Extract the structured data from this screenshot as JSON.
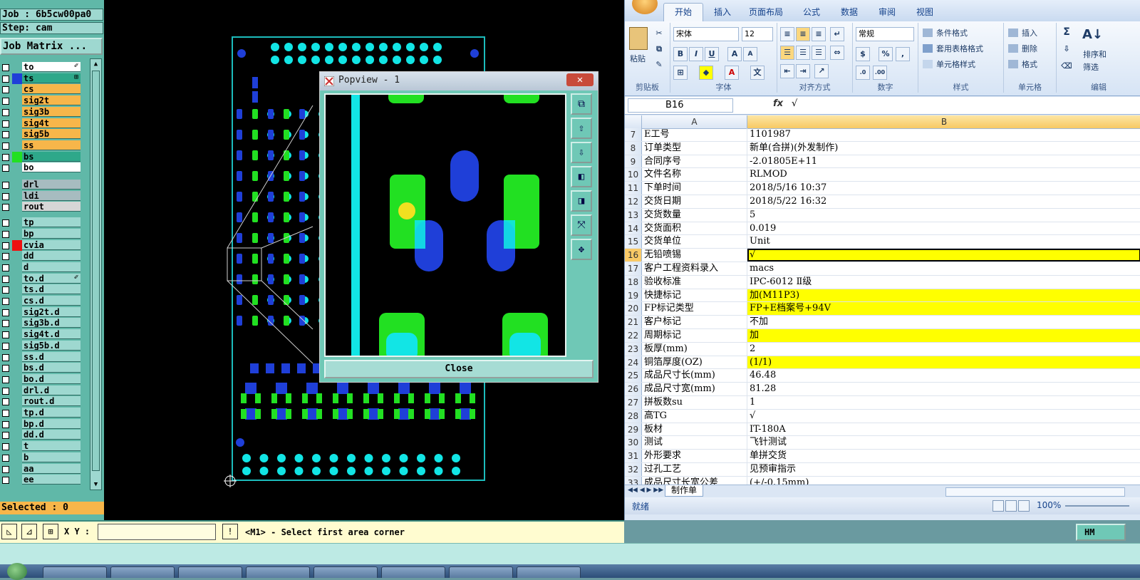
{
  "cam": {
    "job_label": "Job : 6b5cw00pa0",
    "step_label": "Step: cam",
    "job_matrix_button": "Job Matrix ...",
    "selected_label": "Selected : 0",
    "layers": [
      {
        "name": "to",
        "color": "#ffffff",
        "swatch": "",
        "mark": "✐"
      },
      {
        "name": "ts",
        "color": "#2ea88a",
        "swatch": "#1f3fd8",
        "mark": "⊞"
      },
      {
        "name": "cs",
        "color": "#f7b64a",
        "swatch": "",
        "mark": ""
      },
      {
        "name": "sig2t",
        "color": "#f7b64a",
        "swatch": "",
        "mark": ""
      },
      {
        "name": "sig3b",
        "color": "#f7b64a",
        "swatch": "",
        "mark": ""
      },
      {
        "name": "sig4t",
        "color": "#f7b64a",
        "swatch": "",
        "mark": ""
      },
      {
        "name": "sig5b",
        "color": "#f7b64a",
        "swatch": "",
        "mark": ""
      },
      {
        "name": "ss",
        "color": "#f7b64a",
        "swatch": "",
        "mark": ""
      },
      {
        "name": "bs",
        "color": "#2ea88a",
        "swatch": "#22e022",
        "mark": ""
      },
      {
        "name": "bo",
        "color": "#ffffff",
        "swatch": "",
        "mark": ""
      },
      {
        "name": "drl",
        "color": "#a7bcc0",
        "swatch": "",
        "mark": ""
      },
      {
        "name": "ldi",
        "color": "#a7bcc0",
        "swatch": "",
        "mark": ""
      },
      {
        "name": "rout",
        "color": "#d6d6d6",
        "swatch": "",
        "mark": ""
      },
      {
        "name": "tp",
        "color": "#9ed8d0",
        "swatch": "",
        "mark": ""
      },
      {
        "name": "bp",
        "color": "#9ed8d0",
        "swatch": "",
        "mark": ""
      },
      {
        "name": "cvia",
        "color": "#9ed8d0",
        "swatch": "#ee1111",
        "mark": ""
      },
      {
        "name": "dd",
        "color": "#9ed8d0",
        "swatch": "",
        "mark": ""
      },
      {
        "name": "d",
        "color": "#9ed8d0",
        "swatch": "",
        "mark": ""
      },
      {
        "name": "to.d",
        "color": "#9ed8d0",
        "swatch": "",
        "mark": "✐"
      },
      {
        "name": "ts.d",
        "color": "#9ed8d0",
        "swatch": "",
        "mark": ""
      },
      {
        "name": "cs.d",
        "color": "#9ed8d0",
        "swatch": "",
        "mark": ""
      },
      {
        "name": "sig2t.d",
        "color": "#9ed8d0",
        "swatch": "",
        "mark": ""
      },
      {
        "name": "sig3b.d",
        "color": "#9ed8d0",
        "swatch": "",
        "mark": ""
      },
      {
        "name": "sig4t.d",
        "color": "#9ed8d0",
        "swatch": "",
        "mark": ""
      },
      {
        "name": "sig5b.d",
        "color": "#9ed8d0",
        "swatch": "",
        "mark": ""
      },
      {
        "name": "ss.d",
        "color": "#9ed8d0",
        "swatch": "",
        "mark": ""
      },
      {
        "name": "bs.d",
        "color": "#9ed8d0",
        "swatch": "",
        "mark": ""
      },
      {
        "name": "bo.d",
        "color": "#9ed8d0",
        "swatch": "",
        "mark": ""
      },
      {
        "name": "drl.d",
        "color": "#9ed8d0",
        "swatch": "",
        "mark": ""
      },
      {
        "name": "rout.d",
        "color": "#9ed8d0",
        "swatch": "",
        "mark": ""
      },
      {
        "name": "tp.d",
        "color": "#9ed8d0",
        "swatch": "",
        "mark": ""
      },
      {
        "name": "bp.d",
        "color": "#9ed8d0",
        "swatch": "",
        "mark": ""
      },
      {
        "name": "dd.d",
        "color": "#9ed8d0",
        "swatch": "",
        "mark": ""
      },
      {
        "name": "t",
        "color": "#9ed8d0",
        "swatch": "",
        "mark": ""
      },
      {
        "name": "b",
        "color": "#9ed8d0",
        "swatch": "",
        "mark": ""
      },
      {
        "name": "aa",
        "color": "#9ed8d0",
        "swatch": "",
        "mark": ""
      },
      {
        "name": "ee",
        "color": "#9ed8d0",
        "swatch": "",
        "mark": ""
      }
    ],
    "popview": {
      "title": "Popview - 1",
      "close_x": "✕",
      "close_button": "Close",
      "tools": [
        "zoom-window-icon",
        "layer-up-icon",
        "layer-down-icon",
        "pan-left-icon",
        "pan-right-icon",
        "zoom-fit-icon",
        "zoom-home-icon"
      ]
    },
    "xy_label": "X Y :",
    "xy_value": "",
    "message": "<M1> - Select first area corner",
    "info_button": "!",
    "hm_button": "HM",
    "colors": {
      "copper": "#22e022",
      "pad": "#1f3fd8",
      "via": "#12e5e5",
      "board": "#1cbcbc"
    }
  },
  "excel": {
    "ribbon_tabs": [
      "开始",
      "插入",
      "页面布局",
      "公式",
      "数据",
      "审阅",
      "视图"
    ],
    "clipboard": {
      "paste": "粘贴",
      "label": "剪贴板"
    },
    "font": {
      "name": "宋体",
      "size": "12",
      "label": "字体"
    },
    "alignment_label": "对齐方式",
    "number": {
      "format": "常规",
      "label": "数字"
    },
    "styles": {
      "conditional": "条件格式",
      "table": "套用表格格式",
      "cell": "单元格样式",
      "label": "样式"
    },
    "cells": {
      "insert": "插入",
      "delete": "删除",
      "format": "格式",
      "label": "单元格"
    },
    "editing": {
      "sigma": "Σ",
      "sort": "排序和",
      "filter": "筛选",
      "label": "编辑"
    },
    "name_box": "B16",
    "fx": "fx",
    "formula": "√",
    "col_a": "A",
    "col_b": "B",
    "rows": [
      {
        "n": "7",
        "a": "E工号",
        "b": "1101987",
        "hl": false
      },
      {
        "n": "8",
        "a": "订单类型",
        "b": "新单(合拼)(外发制作)",
        "hl": false
      },
      {
        "n": "9",
        "a": "合同序号",
        "b": "-2.01805E+11",
        "hl": false
      },
      {
        "n": "10",
        "a": "文件名称",
        "b": "RLMOD",
        "hl": false
      },
      {
        "n": "11",
        "a": "下单时间",
        "b": "2018/5/16 10:37",
        "hl": false
      },
      {
        "n": "12",
        "a": "交货日期",
        "b": "2018/5/22 16:32",
        "hl": false
      },
      {
        "n": "13",
        "a": "交货数量",
        "b": "5",
        "hl": false
      },
      {
        "n": "14",
        "a": "交货面积",
        "b": "0.019",
        "hl": false
      },
      {
        "n": "15",
        "a": "交货单位",
        "b": "Unit",
        "hl": false
      },
      {
        "n": "16",
        "a": "无铅喷锡",
        "b": "√",
        "hl": true
      },
      {
        "n": "17",
        "a": "客户工程资料录入",
        "b": "macs",
        "hl": false
      },
      {
        "n": "18",
        "a": "验收标准",
        "b": "IPC-6012 Ⅱ级",
        "hl": false
      },
      {
        "n": "19",
        "a": "快捷标记",
        "b": "加(M11P3)",
        "hl": true
      },
      {
        "n": "20",
        "a": "FP标记类型",
        "b": "FP+E档案号+94V",
        "hl": true
      },
      {
        "n": "21",
        "a": "客户标记",
        "b": "不加",
        "hl": false
      },
      {
        "n": "22",
        "a": "周期标记",
        "b": "加",
        "hl": true
      },
      {
        "n": "23",
        "a": "板厚(mm)",
        "b": "2",
        "hl": false
      },
      {
        "n": "24",
        "a": "铜箔厚度(OZ)",
        "b": " (1/1)",
        "hl": true
      },
      {
        "n": "25",
        "a": "成品尺寸长(mm)",
        "b": "46.48",
        "hl": false
      },
      {
        "n": "26",
        "a": "成品尺寸宽(mm)",
        "b": "81.28",
        "hl": false
      },
      {
        "n": "27",
        "a": "拼板数su",
        "b": "1",
        "hl": false
      },
      {
        "n": "28",
        "a": "高TG",
        "b": "√",
        "hl": false
      },
      {
        "n": "29",
        "a": "板材",
        "b": "IT-180A",
        "hl": false
      },
      {
        "n": "30",
        "a": "测试",
        "b": "飞针测试",
        "hl": false
      },
      {
        "n": "31",
        "a": "外形要求",
        "b": "单拼交货",
        "hl": false
      },
      {
        "n": "32",
        "a": "过孔工艺",
        "b": "见预审指示",
        "hl": false
      },
      {
        "n": "33",
        "a": "成品尺寸长宽公差",
        "b": "(+/-0.15mm)",
        "hl": false
      }
    ],
    "selected_row": "16",
    "sheet_tab": "制作单",
    "status": "就绪",
    "zoom": "100%",
    "highlight_color": "#ffff00"
  }
}
